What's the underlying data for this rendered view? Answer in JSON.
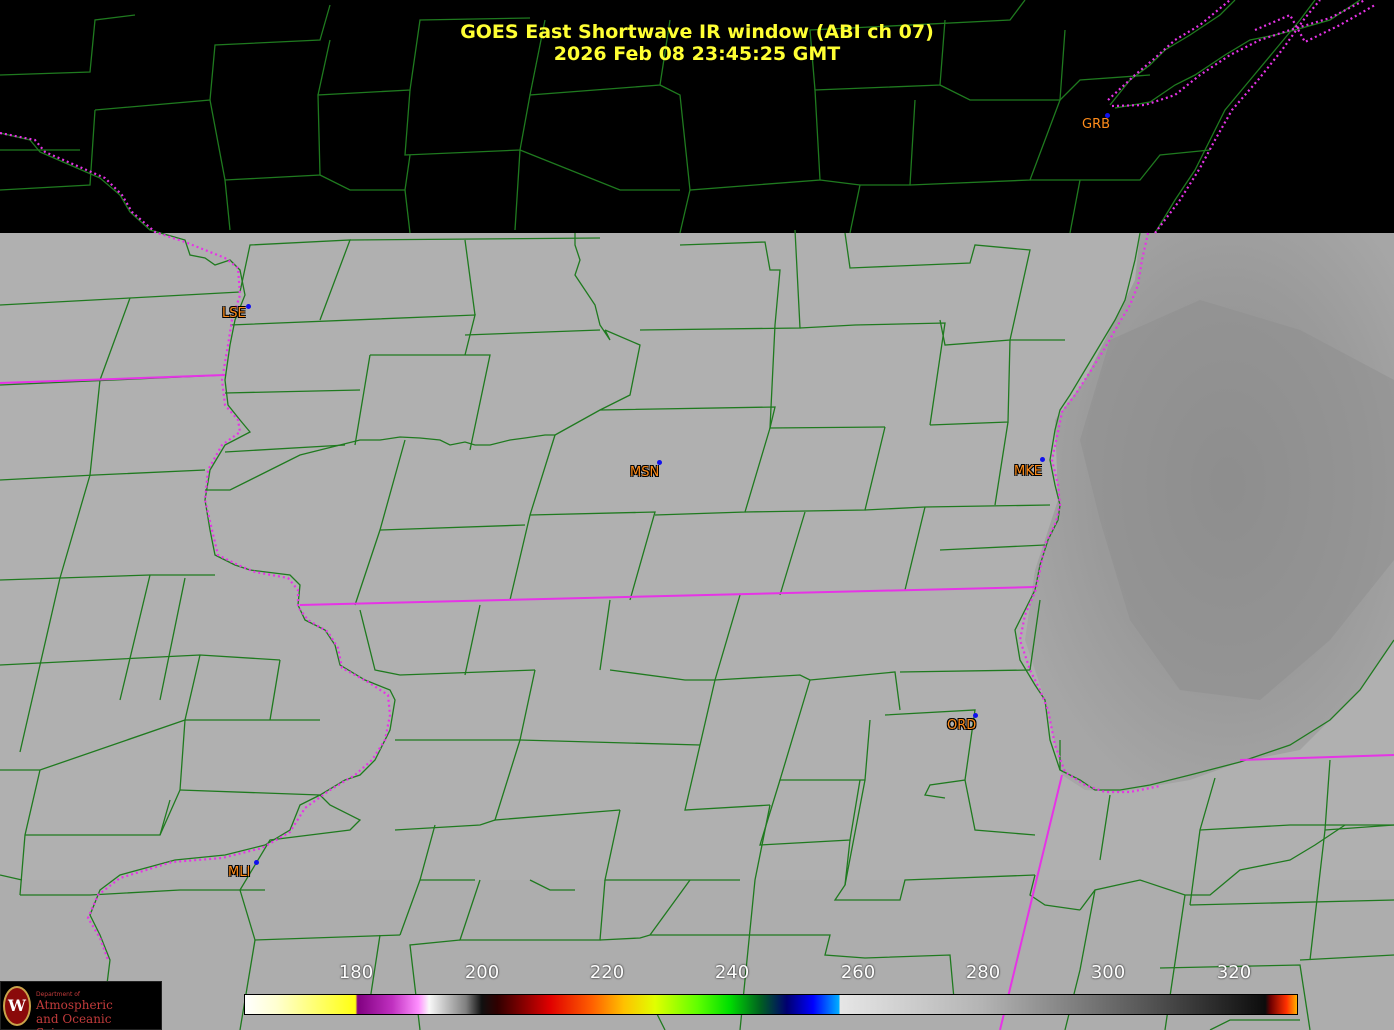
{
  "title": {
    "line1": "GOES East Shortwave IR window (ABI ch 07)",
    "line2": "2026 Feb 08  23:45:25 GMT"
  },
  "stations": [
    {
      "code": "GRB",
      "id": "grb"
    },
    {
      "code": "LSE",
      "id": "lse"
    },
    {
      "code": "MSN",
      "id": "msn"
    },
    {
      "code": "MKE",
      "id": "mke"
    },
    {
      "code": "ORD",
      "id": "ord"
    },
    {
      "code": "MLI",
      "id": "mli"
    }
  ],
  "colorbar": {
    "ticks": [
      "180",
      "200",
      "220",
      "240",
      "260",
      "280",
      "300",
      "320"
    ]
  },
  "logo": {
    "seal_letter": "W",
    "dept": "Department of",
    "line1": "Atmospheric",
    "line2": "and Oceanic Sciences"
  },
  "colors": {
    "title": "#ffff33",
    "county_lines": "#1f7a1f",
    "state_lines": "#e633e6",
    "station_labels": "#ff8c1a",
    "station_dots": "#1010ee"
  }
}
